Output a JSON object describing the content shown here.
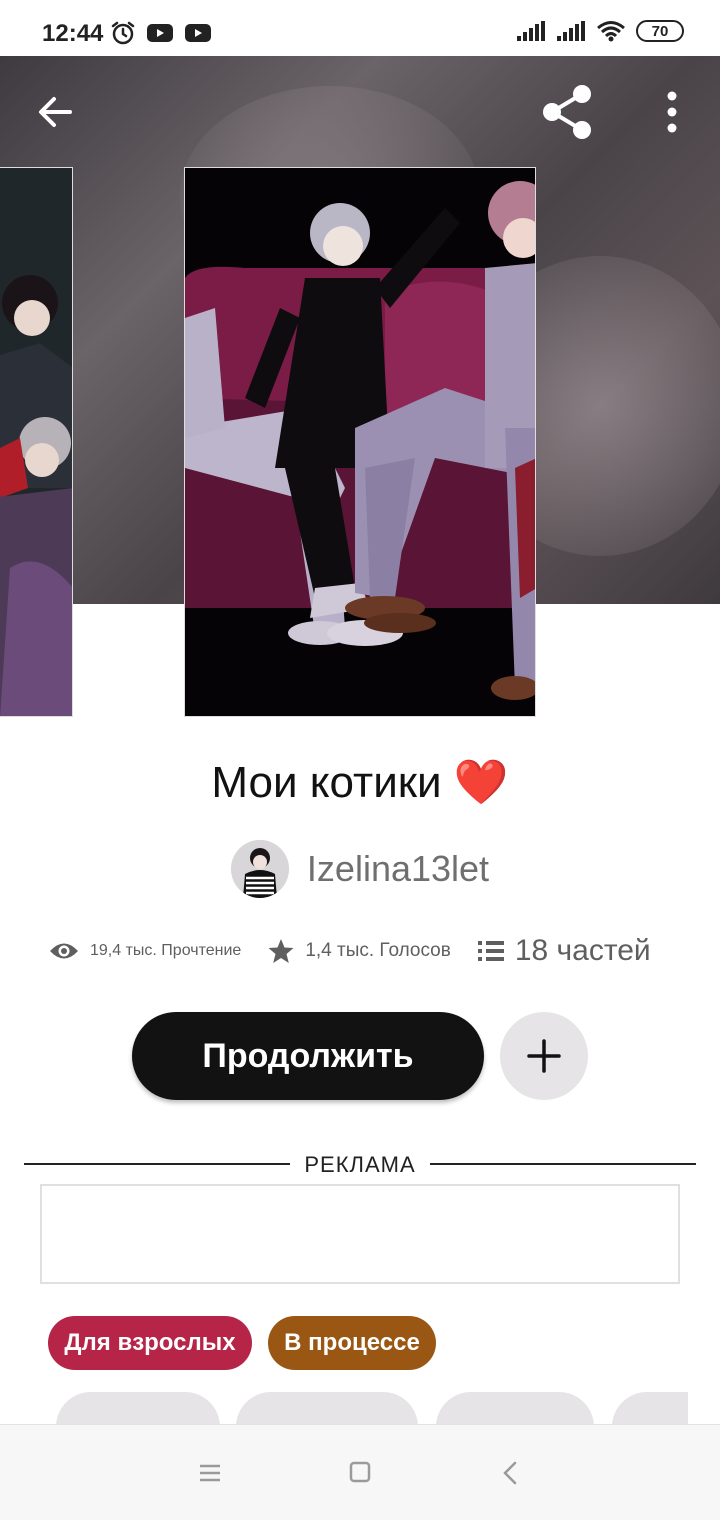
{
  "status_bar": {
    "time": "12:44",
    "battery": "70",
    "icons_left": [
      "alarm-icon",
      "youtube-icon",
      "youtube-icon"
    ],
    "icons_right": [
      "signal-icon",
      "signal-icon",
      "wifi-icon",
      "battery-icon"
    ]
  },
  "header": {
    "icons": [
      "arrow-left-icon",
      "share-icon",
      "more-vertical-icon"
    ]
  },
  "story": {
    "title": "Мои котики ❤️",
    "author": "Izelina13let",
    "stats": {
      "reads": "19,4 тыс. Прочтение",
      "votes": "1,4 тыс. Голосов",
      "parts": "18 частей"
    },
    "continue_label": "Продолжить",
    "add_icon": "plus-icon"
  },
  "ad": {
    "label": "РЕКЛАМА"
  },
  "tags": {
    "mature": "Для взрослых",
    "ongoing": "В процессе"
  },
  "colors": {
    "primary_button": "#121212",
    "tag_mature": "#b62547",
    "tag_ongoing": "#9a5613",
    "secondary_button": "#e6e4e6"
  },
  "nav_bar": {
    "icons": [
      "menu-icon",
      "home-square-icon",
      "back-chevron-icon"
    ]
  }
}
